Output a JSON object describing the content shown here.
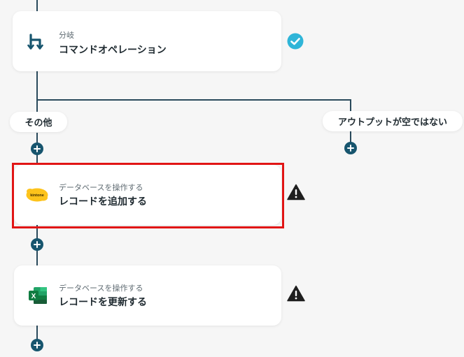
{
  "branch_node": {
    "sublabel": "分岐",
    "title": "コマンドオペレーション",
    "icon": "branch-icon",
    "status": "complete"
  },
  "branches": [
    {
      "label": "その他"
    },
    {
      "label": "アウトプットが空ではない"
    }
  ],
  "steps": [
    {
      "sublabel": "データベースを操作する",
      "title": "レコードを追加する",
      "icon": "kintone-logo-icon",
      "logo_text": "kintone",
      "status": "warning",
      "selected": true
    },
    {
      "sublabel": "データベースを操作する",
      "title": "レコードを更新する",
      "icon": "excel-icon",
      "logo_text": "X",
      "status": "warning",
      "selected": false
    }
  ],
  "colors": {
    "connector": "#2a4a5c",
    "plus_button": "#17556e",
    "check_badge": "#2fb5d8",
    "warning": "#1f1f1f",
    "selection": "#e11515",
    "kintone": "#fdc31b",
    "excel": "#1d7a45"
  }
}
